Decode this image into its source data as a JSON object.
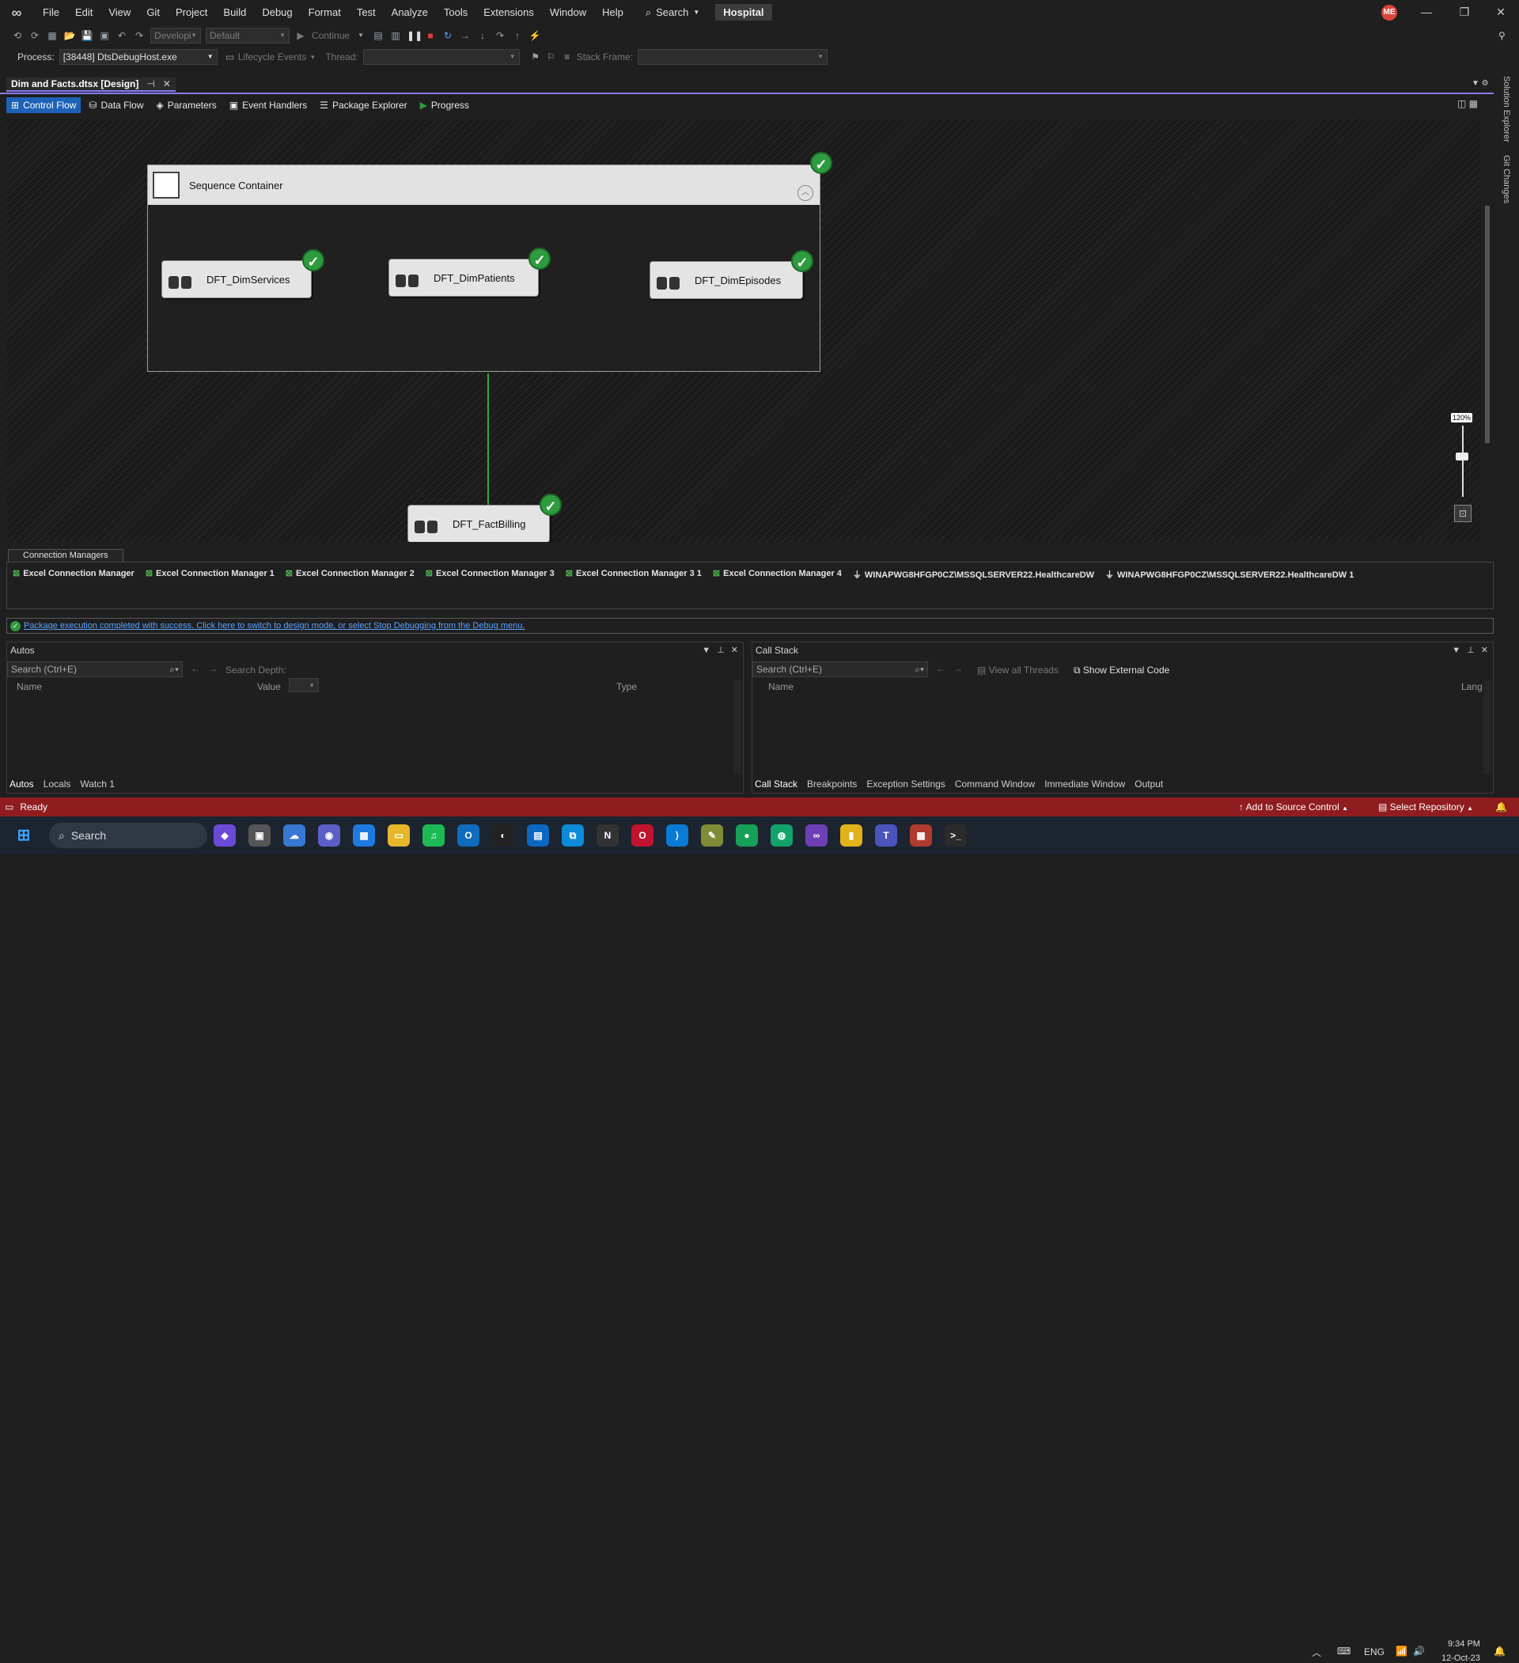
{
  "menu": [
    "File",
    "Edit",
    "View",
    "Git",
    "Project",
    "Build",
    "Debug",
    "Format",
    "Test",
    "Analyze",
    "Tools",
    "Extensions",
    "Window",
    "Help"
  ],
  "search_label": "Search",
  "solution_name": "Hospital",
  "user_initials": "ME",
  "toolbar": {
    "config": "Developi",
    "platform": "Default",
    "continue_label": "Continue"
  },
  "debugbar": {
    "process_label": "Process:",
    "process_value": "[38448] DtsDebugHost.exe",
    "lifecycle_label": "Lifecycle Events",
    "thread_label": "Thread:",
    "stackframe_label": "Stack Frame:"
  },
  "document_tab": "Dim and Facts.dtsx [Design]",
  "design_tabs": [
    "Control Flow",
    "Data Flow",
    "Parameters",
    "Event Handlers",
    "Package Explorer",
    "Progress"
  ],
  "sequence_container": {
    "title": "Sequence Container"
  },
  "tasks": {
    "t1": "DFT_DimServices",
    "t2": "DFT_DimPatients",
    "t3": "DFT_DimEpisodes",
    "t4": "DFT_FactBilling"
  },
  "zoom_label": "120%",
  "connection_managers": {
    "tab": "Connection Managers",
    "items": [
      "Excel Connection Manager",
      "Excel Connection Manager 1",
      "Excel Connection Manager 2",
      "Excel Connection Manager 3",
      "Excel Connection Manager 3 1",
      "Excel Connection Manager 4",
      "WINAPWG8HFGP0CZ\\MSSQLSERVER22.HealthcareDW",
      "WINAPWG8HFGP0CZ\\MSSQLSERVER22.HealthcareDW 1"
    ]
  },
  "message": "Package execution completed with success. Click here to switch to design mode, or select Stop Debugging from the Debug menu.",
  "autos": {
    "title": "Autos",
    "search_placeholder": "Search (Ctrl+E)",
    "search_depth": "Search Depth:",
    "columns": [
      "Name",
      "Value",
      "Type"
    ],
    "tabs": [
      "Autos",
      "Locals",
      "Watch 1"
    ]
  },
  "callstack": {
    "title": "Call Stack",
    "search_placeholder": "Search (Ctrl+E)",
    "view_threads": "View all Threads",
    "show_external": "Show External Code",
    "columns": [
      "Name",
      "Lang"
    ],
    "tabs": [
      "Call Stack",
      "Breakpoints",
      "Exception Settings",
      "Command Window",
      "Immediate Window",
      "Output"
    ]
  },
  "status": {
    "ready": "Ready",
    "add_source": "Add to Source Control",
    "select_repo": "Select Repository"
  },
  "side_panels": [
    "Solution Explorer",
    "Git Changes"
  ],
  "taskbar": {
    "search": "Search",
    "lang": "ENG",
    "time": "9:34 PM",
    "date": "12-Oct-23"
  },
  "colors": {
    "accent": "#1e62b8",
    "status_bar": "#8f1c1f",
    "success": "#2e9b3e",
    "link": "#5ba3ff"
  }
}
